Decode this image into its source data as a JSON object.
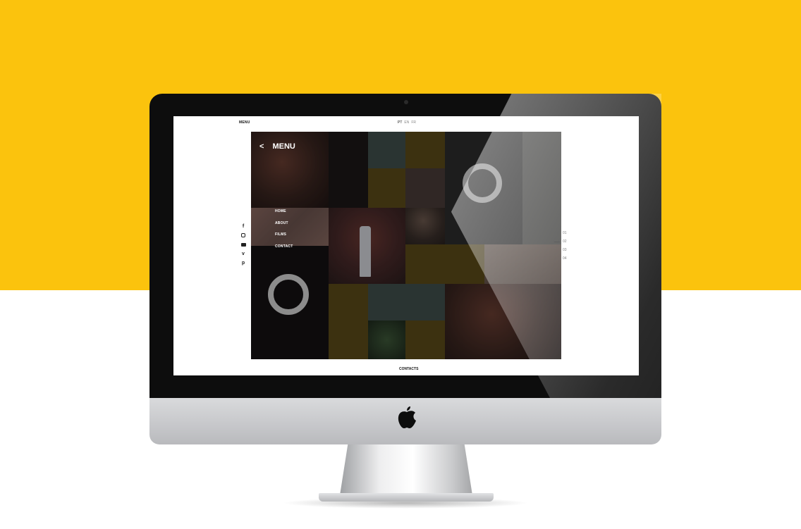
{
  "site": {
    "top_menu_label": "MENU",
    "languages": [
      "PT",
      "EN",
      "FR"
    ],
    "active_language": "PT",
    "footer_link": "CONTACTS"
  },
  "menu_panel": {
    "title": "MENU",
    "back_icon": "chevron-left-icon",
    "items": [
      "HOME",
      "ABOUT",
      "FILMS",
      "CONTACT"
    ]
  },
  "social": [
    "facebook-icon",
    "instagram-icon",
    "youtube-icon",
    "vimeo-icon",
    "pinterest-icon"
  ],
  "pager": {
    "items": [
      "01",
      "02",
      "03",
      "04"
    ],
    "active": "02"
  },
  "colors": {
    "background_accent": "#fbc30d",
    "bezel": "#0d0d0d"
  }
}
